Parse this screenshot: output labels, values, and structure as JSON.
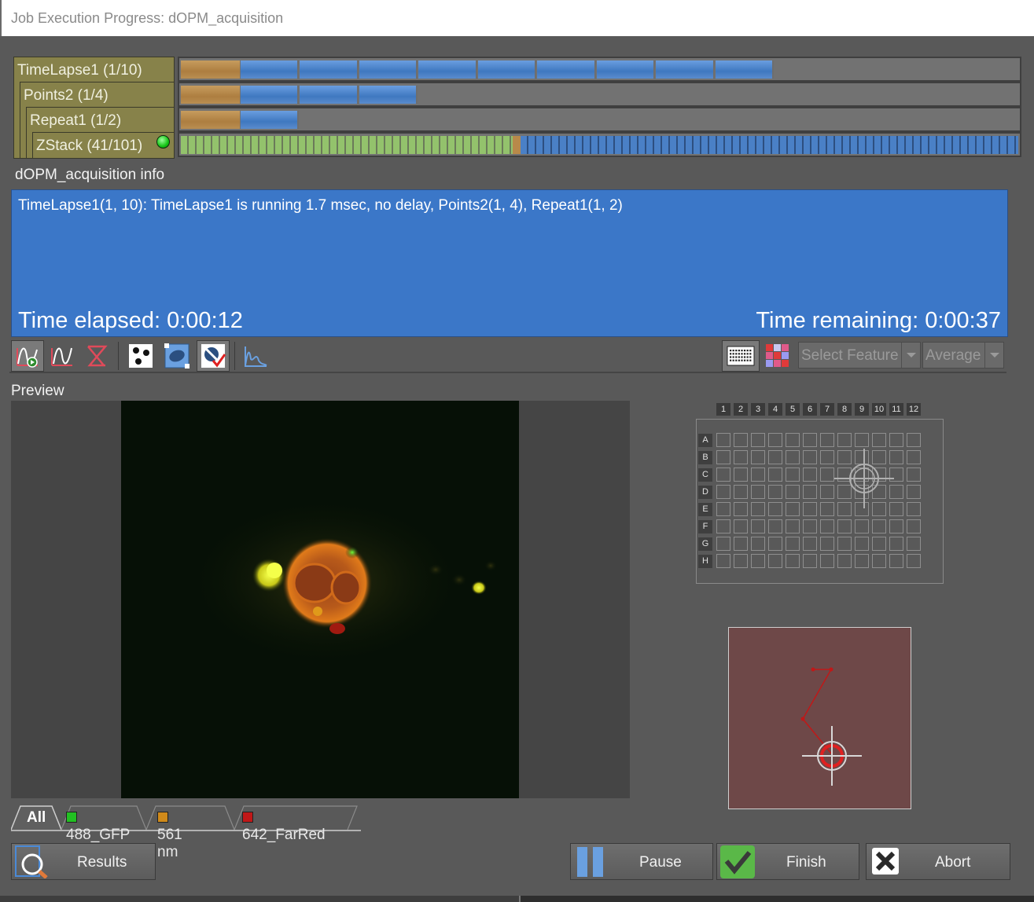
{
  "window": {
    "title": "Job Execution Progress: dOPM_acquisition"
  },
  "tree": [
    {
      "label": "TimeLapse1 (1/10)"
    },
    {
      "label": "Points2 (1/4)"
    },
    {
      "label": "Repeat1 (1/2)"
    },
    {
      "label": "ZStack (41/101)"
    }
  ],
  "progress": {
    "timelapse": {
      "done": 1,
      "total": 10
    },
    "points": {
      "done": 1,
      "total": 4
    },
    "repeat": {
      "done": 1,
      "total": 2
    },
    "zstack": {
      "done": 41,
      "total": 101
    }
  },
  "info": {
    "header": "dOPM_acquisition info",
    "message": "TimeLapse1(1, 10): TimeLapse1 is running 1.7 msec, no delay, Points2(1, 4), Repeat1(1, 2)",
    "elapsed": "Time elapsed: 0:00:12",
    "remaining": "Time remaining: 0:00:37"
  },
  "toolbar": {
    "feature_select": "Select Feature",
    "average_select": "Average"
  },
  "preview": {
    "label": "Preview"
  },
  "plate": {
    "columns": [
      "1",
      "2",
      "3",
      "4",
      "5",
      "6",
      "7",
      "8",
      "9",
      "10",
      "11",
      "12"
    ],
    "rows": [
      "A",
      "B",
      "C",
      "D",
      "E",
      "F",
      "G",
      "H"
    ]
  },
  "channels": {
    "all": "All",
    "tabs": [
      {
        "label": "488_GFP",
        "color": "#22c022"
      },
      {
        "label": "561 nm",
        "color": "#d08a1a"
      },
      {
        "label": "642_FarRed",
        "color": "#c01818"
      }
    ]
  },
  "buttons": {
    "results": "Results",
    "pause": "Pause",
    "finish": "Finish",
    "abort": "Abort"
  },
  "colors": {
    "accent": "#3b77c8",
    "done": "#b98e52",
    "todo": "#4a80c6",
    "zstack_done": "#93c26c"
  }
}
